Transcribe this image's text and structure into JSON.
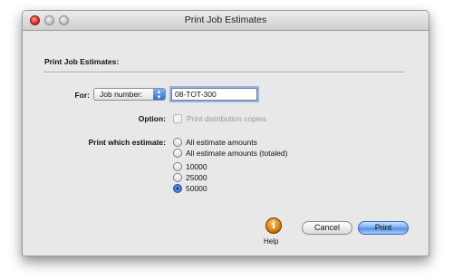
{
  "window": {
    "title": "Print Job Estimates"
  },
  "section": {
    "title": "Print Job Estimates:"
  },
  "for": {
    "label": "For:",
    "select_value": "Job number:",
    "input_value": "08-TOT-300"
  },
  "option": {
    "label": "Option:",
    "checkbox_label": "Print distribution copies",
    "checked": false,
    "enabled": false
  },
  "estimate": {
    "label": "Print which estimate:",
    "options": [
      {
        "label": "All estimate amounts",
        "selected": false
      },
      {
        "label": "All estimate amounts (totaled)",
        "selected": false
      },
      {
        "label": "10000",
        "selected": false
      },
      {
        "label": "25000",
        "selected": false
      },
      {
        "label": "50000",
        "selected": true
      }
    ]
  },
  "help": {
    "label": "Help",
    "icon": "info-icon",
    "glyph": "i"
  },
  "buttons": {
    "cancel": "Cancel",
    "print": "Print"
  },
  "colors": {
    "accent": "#4f8ae4",
    "help_orange": "#d98410"
  }
}
